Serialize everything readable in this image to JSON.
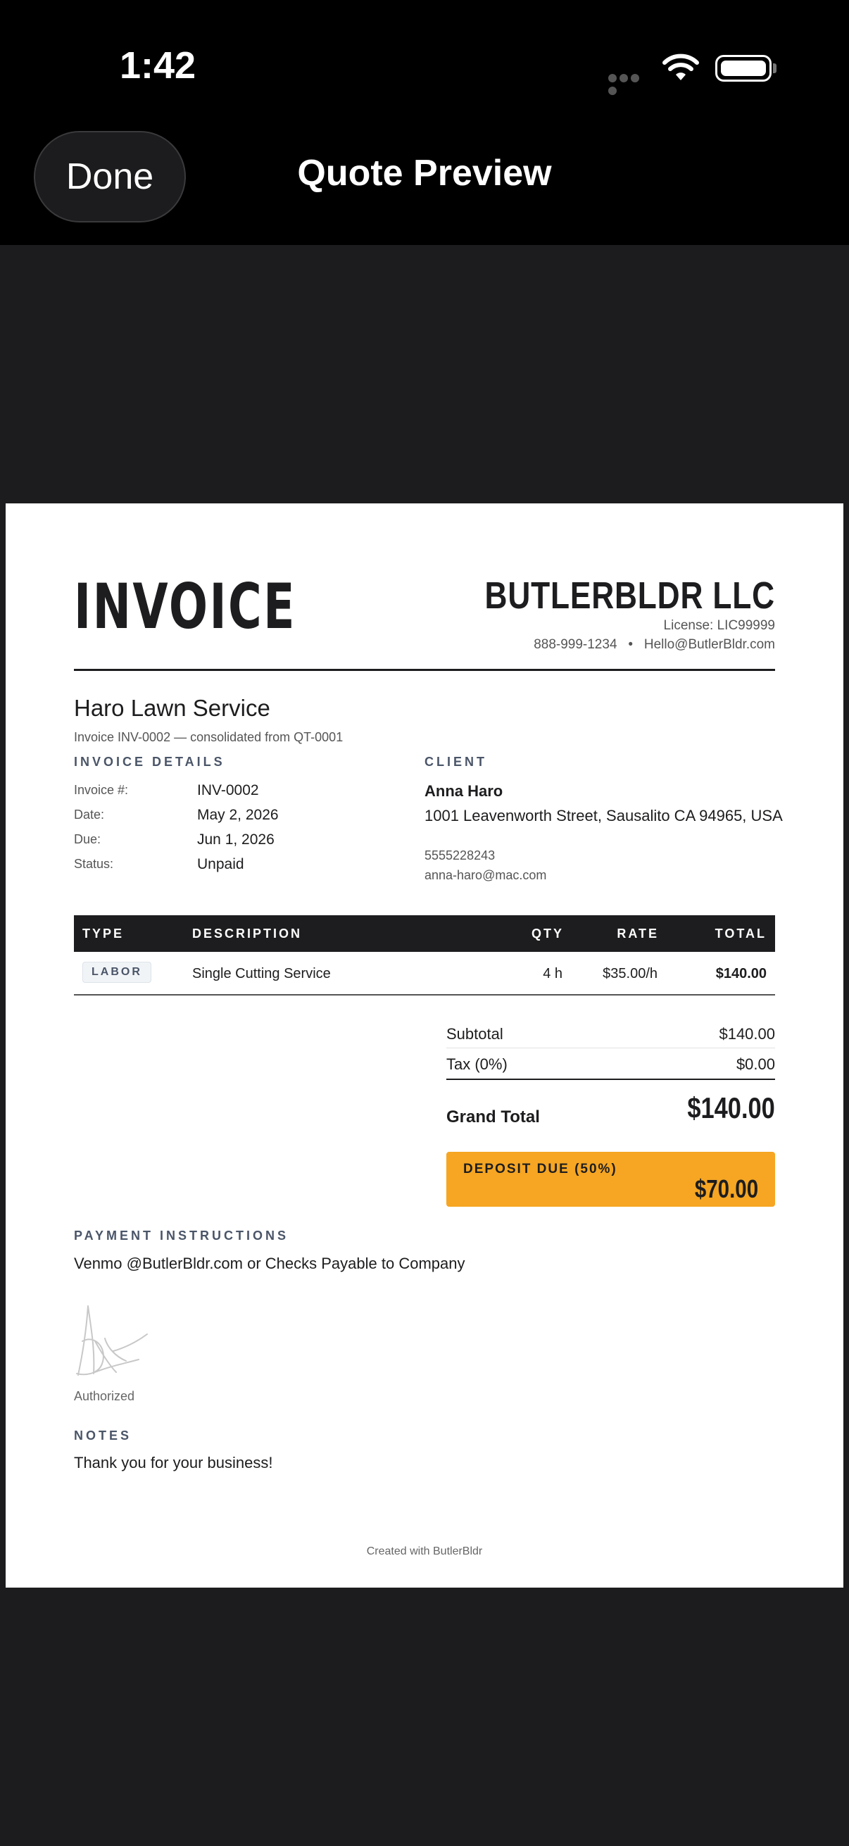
{
  "status_bar": {
    "time": "1:42"
  },
  "nav": {
    "done_label": "Done",
    "title": "Quote Preview"
  },
  "invoice": {
    "heading": "INVOICE",
    "company": "BUTLERBLDR LLC",
    "license": "License: LIC99999",
    "phone": "888-999-1234",
    "separator": "•",
    "email": "Hello@ButlerBldr.com",
    "project": "Haro Lawn Service",
    "subline": "Invoice INV-0002 — consolidated from QT-0001",
    "details_label": "INVOICE DETAILS",
    "details": [
      {
        "key": "Invoice #:",
        "value": "INV-0002"
      },
      {
        "key": "Date:",
        "value": "May 2, 2026"
      },
      {
        "key": "Due:",
        "value": "Jun 1, 2026"
      },
      {
        "key": "Status:",
        "value": "Unpaid"
      }
    ],
    "client_label": "CLIENT",
    "client": {
      "name": "Anna Haro",
      "address": "1001  Leavenworth Street, Sausalito CA 94965, USA",
      "phone": "5555228243",
      "email": "anna-haro@mac.com"
    },
    "table": {
      "headers": [
        "TYPE",
        "DESCRIPTION",
        "QTY",
        "RATE",
        "TOTAL"
      ],
      "rows": [
        {
          "type": "LABOR",
          "description": "Single Cutting Service",
          "qty": "4 h",
          "rate": "$35.00/h",
          "total": "$140.00"
        }
      ]
    },
    "subtotal_label": "Subtotal",
    "subtotal": "$140.00",
    "tax_label": "Tax (0%)",
    "tax": "$0.00",
    "grand_total_label": "Grand Total",
    "grand_total": "$140.00",
    "deposit_label": "DEPOSIT DUE (50%)",
    "deposit": "$70.00",
    "payment_label": "PAYMENT INSTRUCTIONS",
    "payment_text": "Venmo @ButlerBldr.com or Checks Payable to Company",
    "authorized": "Authorized",
    "notes_label": "NOTES",
    "notes_text": "Thank you for your business!",
    "footer": "Created with ButlerBldr"
  }
}
